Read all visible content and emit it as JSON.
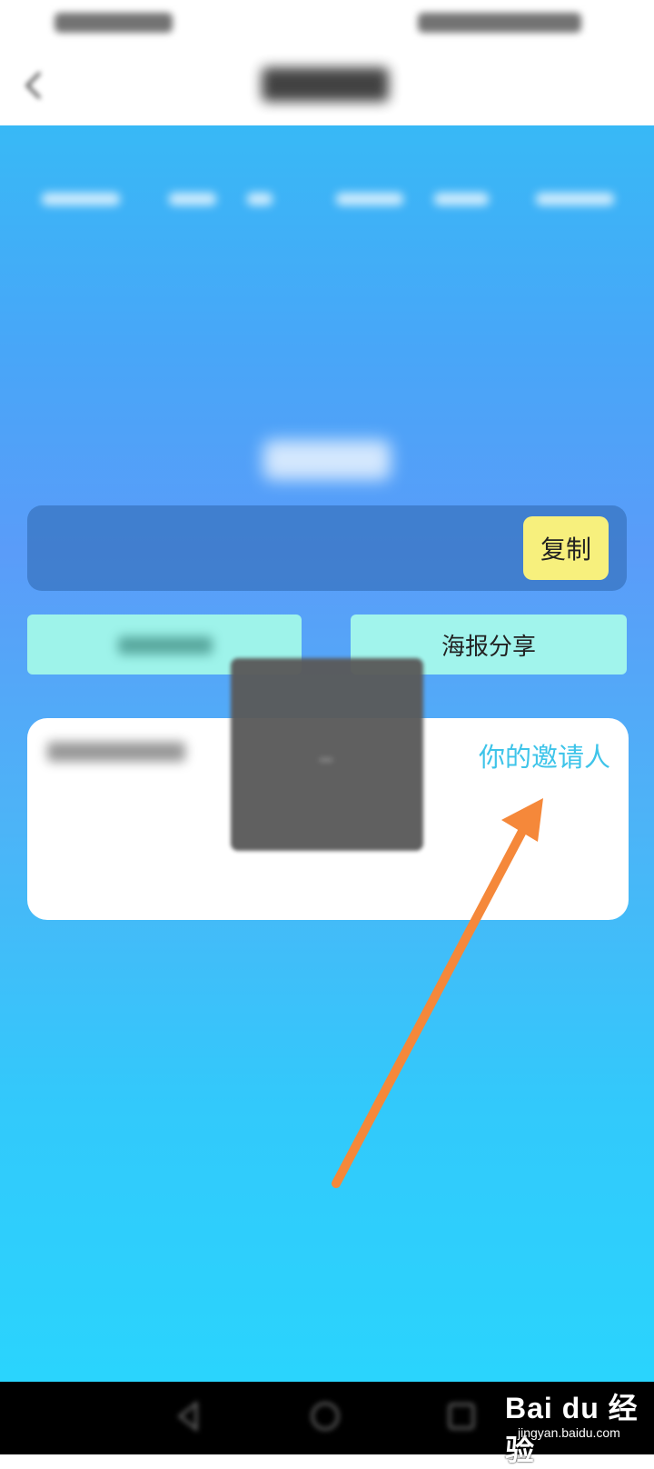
{
  "actions": {
    "copy_label": "复制",
    "poster_share_label": "海报分享"
  },
  "invite_card": {
    "your_inviter_label": "你的邀请人"
  },
  "watermark": {
    "brand": "Bai du 经验",
    "url": "jingyan.baidu.com"
  },
  "colors": {
    "primary_gradient_top": "#38b9f6",
    "primary_gradient_mid": "#5a9cf9",
    "primary_gradient_bottom": "#2ad4fd",
    "copy_button": "#f7f07d",
    "action_button": "#a1f4ec",
    "inviter_link": "#3ec4e9",
    "annotation_arrow": "#f5883a"
  },
  "icons": {
    "back": "back-arrow-icon",
    "nav_back": "nav-back-icon",
    "nav_home": "nav-home-icon",
    "nav_recent": "nav-recent-icon"
  }
}
